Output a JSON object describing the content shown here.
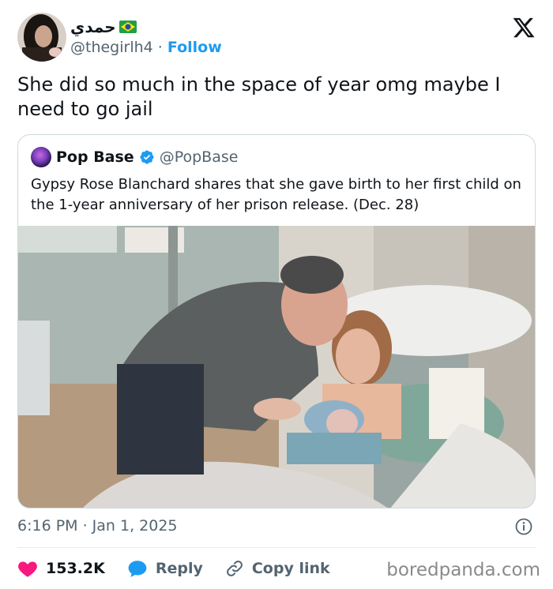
{
  "author": {
    "display_name": "حمدي",
    "handle": "@thegirlh4",
    "separator": "·",
    "follow_label": "Follow",
    "flag": "brazil-flag"
  },
  "tweet": {
    "text": "She did so much in the space of year omg maybe I need to go jail"
  },
  "quoted": {
    "name": "Pop Base",
    "handle": "@PopBase",
    "verified": true,
    "text": "Gypsy Rose Blanchard shares that she gave birth to her first child on the 1-year anniversary of her prison release. (Dec. 28)"
  },
  "meta": {
    "timestamp": "6:16 PM · Jan 1, 2025"
  },
  "actions": {
    "likes": "153.2K",
    "reply_label": "Reply",
    "copy_link_label": "Copy link"
  },
  "watermark": "boredpanda.com",
  "colors": {
    "accent": "#1d9bf0",
    "like": "#f91880",
    "text": "#0f1419",
    "secondary": "#536471"
  }
}
